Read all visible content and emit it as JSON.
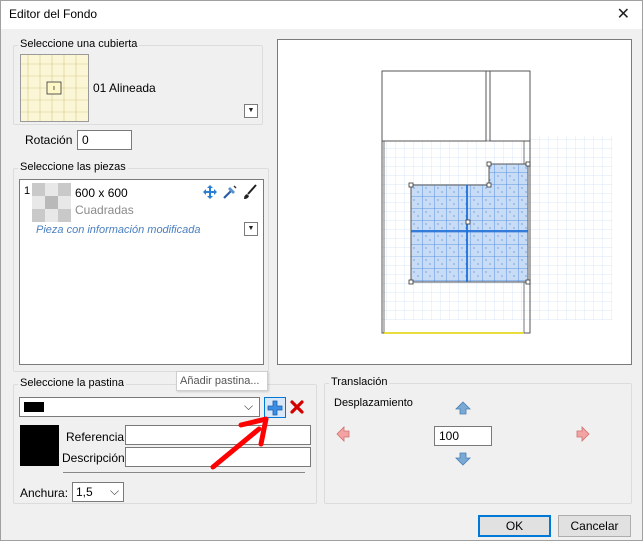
{
  "window": {
    "title": "Editor del Fondo",
    "close": "✕"
  },
  "cover": {
    "group_label": "Seleccione una cubierta",
    "name": "01 Alineada",
    "rotation_label": "Rotación",
    "rotation_value": "0"
  },
  "pieces": {
    "group_label": "Seleccione las piezas",
    "item": {
      "index": "1",
      "size": "600 x 600",
      "pattern": "Cuadradas",
      "note": "Pieza con información modificada"
    }
  },
  "grout": {
    "group_label": "Seleccione la pastina",
    "tooltip": "Añadir pastina...",
    "reference_label": "Referencia",
    "description_label": "Descripción",
    "width_label": "Anchura:",
    "width_value": "1,5",
    "color": "#000000"
  },
  "translation": {
    "group_label": "Translación",
    "offset_label": "Desplazamiento",
    "offset_value": "100"
  },
  "buttons": {
    "ok": "OK",
    "cancel": "Cancelar"
  },
  "colors": {
    "accent": "#0078d7",
    "tile_blue": "#2f7ae5",
    "link_text": "#4a7fc0",
    "arrow_red": "#ff0000"
  }
}
